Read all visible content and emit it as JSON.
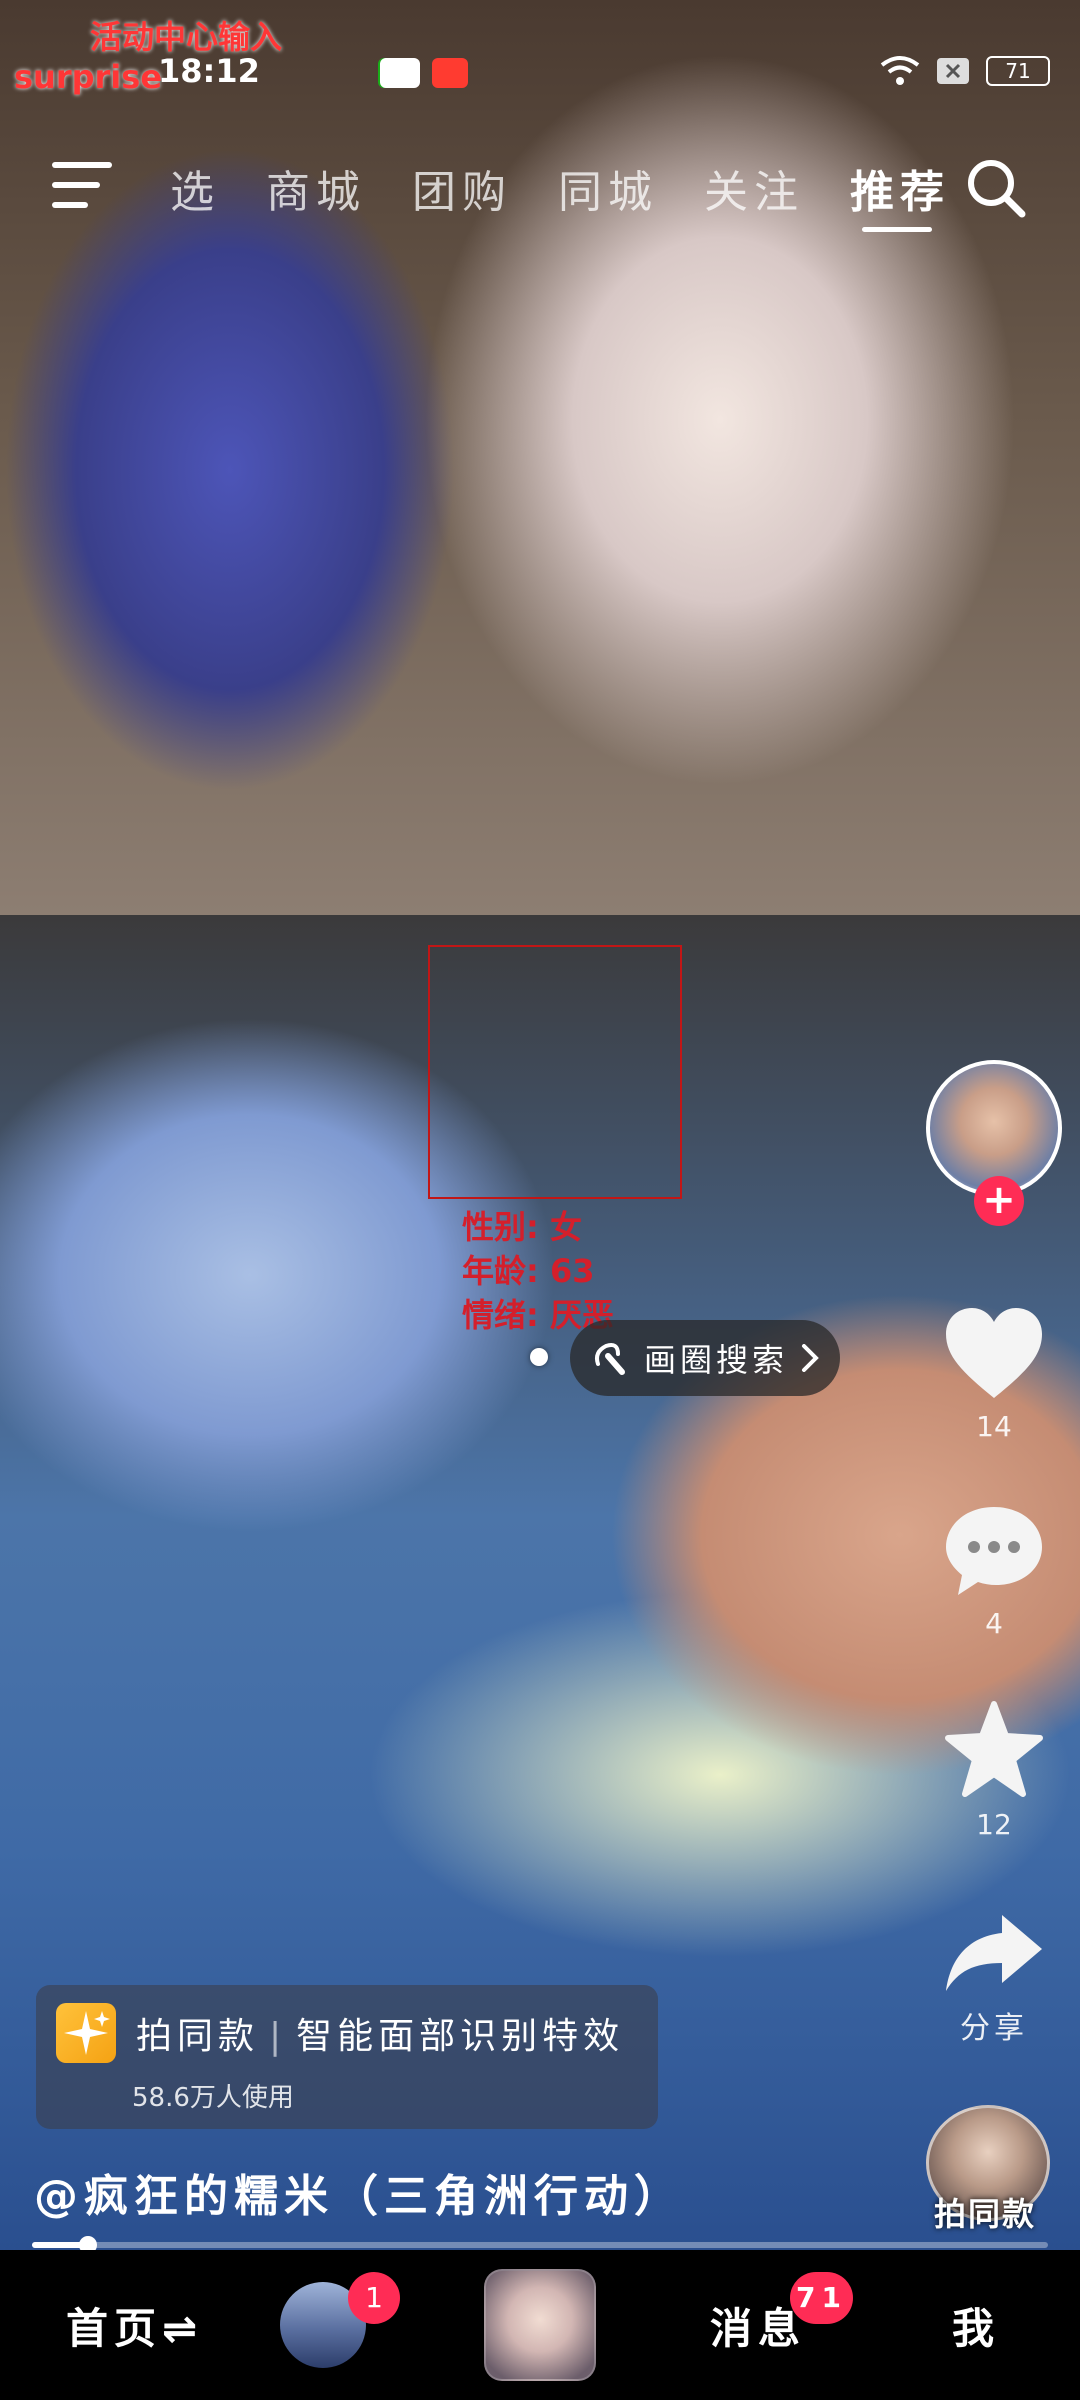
{
  "status_bar": {
    "promo_line1": "活动中心输入",
    "promo_line2": "surprise",
    "clock": "18:12",
    "battery": "71"
  },
  "top_nav": {
    "tabs": [
      {
        "label": "选"
      },
      {
        "label": "商城"
      },
      {
        "label": "团购"
      },
      {
        "label": "同城"
      },
      {
        "label": "关注"
      },
      {
        "label": "推荐"
      }
    ],
    "active_tab": "推荐"
  },
  "face_overlay": {
    "gender": "性别:  女",
    "age": "年龄:  63",
    "mood": "情绪:  厌恶"
  },
  "draw_search": {
    "label": "画圈搜索"
  },
  "rail": {
    "like_count": "14",
    "comment_count": "4",
    "favorite_count": "12",
    "share_label": "分享"
  },
  "effect_card": {
    "title": "拍同款",
    "separator": "|",
    "effect_name": "智能面部识别特效",
    "users": "58.6万人使用"
  },
  "author_line": "@疯狂的糯米（三角洲行动）",
  "same_style_label": "拍同款",
  "progress": {
    "fraction": 0.055
  },
  "bottom_nav": {
    "home": "首页⇌",
    "friends_badge": "1",
    "messages": "消息",
    "messages_badge": "71",
    "me": "我"
  },
  "colors": {
    "accent": "#ff2c55",
    "face_box": "#c21616",
    "effect_icon": "#f5a213"
  },
  "icons": [
    "menu-icon",
    "search-icon",
    "heart-icon",
    "comment-icon",
    "star-icon",
    "share-icon",
    "draw-pen-icon",
    "chevron-right-icon",
    "sparkle-icon",
    "wifi-icon"
  ]
}
